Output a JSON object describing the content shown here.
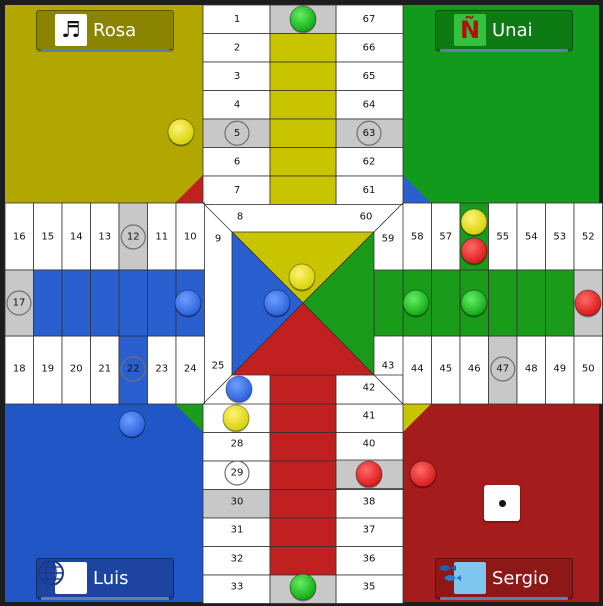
{
  "players": {
    "rosa": {
      "name": "Rosa",
      "icon": "music-notes-icon",
      "color": "#c8c400"
    },
    "unai": {
      "name": "Unai",
      "icon": "letter-enye-icon",
      "glyph": "Ñ",
      "color": "#1a9c1a"
    },
    "luis": {
      "name": "Luis",
      "icon": "globe-icon",
      "color": "#2a5fd0"
    },
    "sergio": {
      "name": "Sergio",
      "icon": "fish-puzzle-icon",
      "color": "#c02020"
    }
  },
  "colors": {
    "yellow": "#c8c400",
    "yellow_home": "#b2a600",
    "green": "#1a9c1a",
    "green_home": "#119a1c",
    "blue": "#2a5fd0",
    "blue_home": "#2156c6",
    "red": "#c02020",
    "red_home": "#a51c1c",
    "safe_gray": "#c8c8c8"
  },
  "tracks": {
    "top_left": [
      "1",
      "2",
      "3",
      "4",
      "5",
      "6",
      "7",
      "8"
    ],
    "top_right": [
      "67",
      "66",
      "65",
      "64",
      "63",
      "62",
      "61",
      "60"
    ],
    "left_upper": [
      "16",
      "15",
      "14",
      "13",
      "12",
      "11",
      "10",
      "9"
    ],
    "left_lower": [
      "18",
      "19",
      "20",
      "21",
      "22",
      "23",
      "24",
      "25"
    ],
    "left_safe": "17",
    "right_upper": [
      "59",
      "58",
      "57",
      "56",
      "55",
      "54",
      "53",
      "52"
    ],
    "right_lower": [
      "43",
      "44",
      "45",
      "46",
      "47",
      "48",
      "49",
      "50"
    ],
    "right_safe": "51",
    "bottom_left": [
      "26",
      "27",
      "28",
      "29",
      "30",
      "31",
      "32",
      "33"
    ],
    "bottom_right": [
      "42",
      "41",
      "40",
      "39",
      "38",
      "37",
      "36",
      "35"
    ],
    "bottom_safe": "34",
    "top_safe": "68"
  },
  "safe_squares": [
    "5",
    "12",
    "17",
    "22",
    "29",
    "46",
    "63"
  ],
  "die": {
    "value": 1
  }
}
